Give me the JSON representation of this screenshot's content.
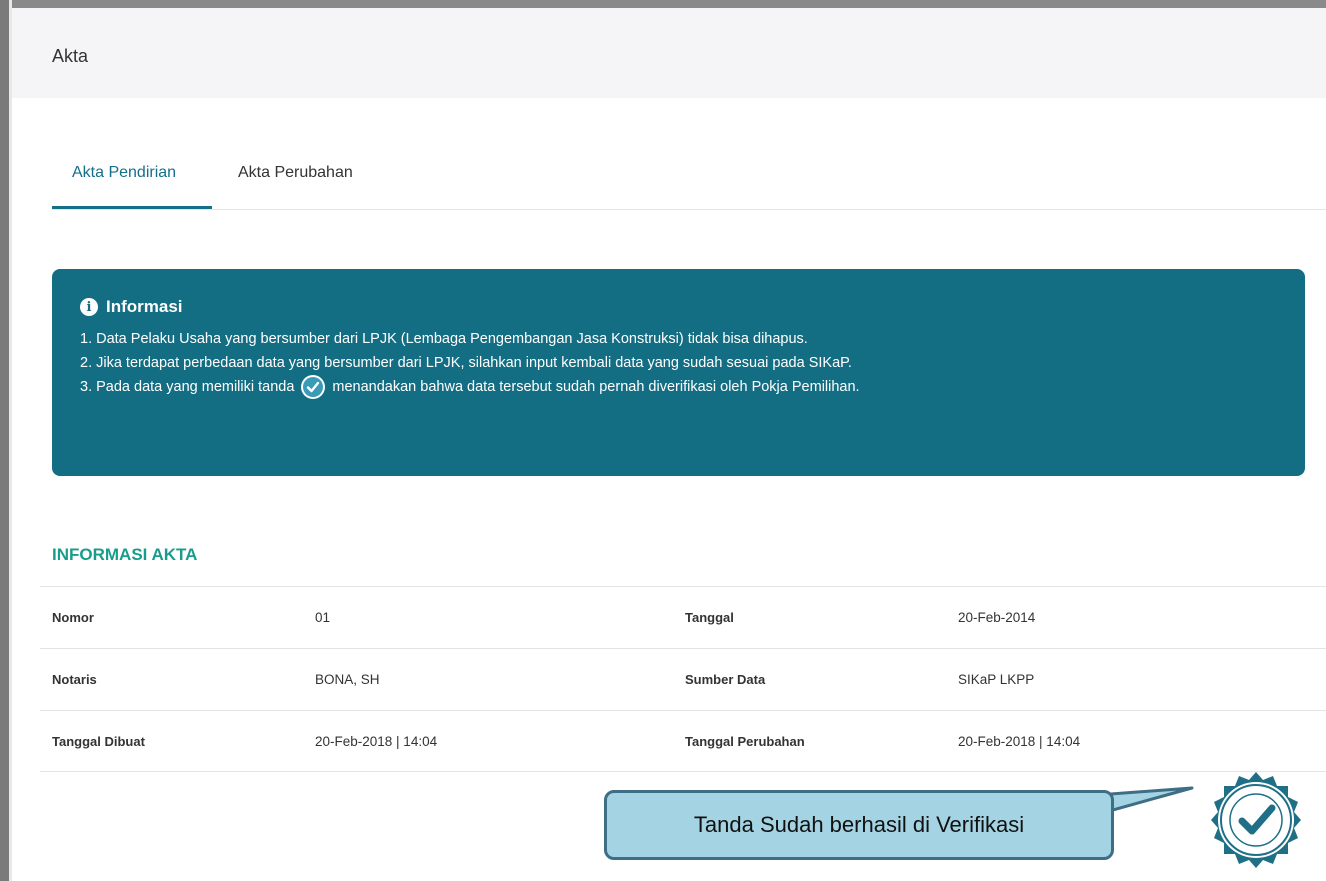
{
  "panel": {
    "title": "Akta"
  },
  "tabs": [
    {
      "label": "Akta Pendirian",
      "active": true
    },
    {
      "label": "Akta Perubahan",
      "active": false
    }
  ],
  "info": {
    "title": "Informasi",
    "icon": "info-circle-icon",
    "line1": "1. Data Pelaku Usaha yang bersumber dari LPJK (Lembaga Pengembangan Jasa Konstruksi) tidak bisa dihapus.",
    "line2": "2. Jika terdapat perbedaan data yang bersumber dari LPJK, silahkan input kembali data yang sudah sesuai pada SIKaP.",
    "line3_before": "3. Pada data yang memiliki tanda",
    "line3_after": "menandakan bahwa data tersebut sudah pernah diverifikasi oleh Pokja Pemilihan.",
    "background": "#136e83"
  },
  "section": {
    "title": "INFORMASI AKTA"
  },
  "table": {
    "rows": [
      {
        "label1": "Nomor",
        "value1": "01",
        "label2": "Tanggal",
        "value2": "20-Feb-2014"
      },
      {
        "label1": "Notaris",
        "value1": "BONA, SH",
        "label2": "Sumber Data",
        "value2": "SIKaP LKPP"
      },
      {
        "label1": "Tanggal Dibuat",
        "value1": "20-Feb-2018 | 14:04",
        "label2": "Tanggal Perubahan",
        "value2": "20-Feb-2018 | 14:04"
      }
    ]
  },
  "callout": {
    "text": "Tanda Sudah berhasil di Verifikasi"
  },
  "seal": {
    "icon": "verified-seal-icon",
    "color": "#1f6f86"
  }
}
